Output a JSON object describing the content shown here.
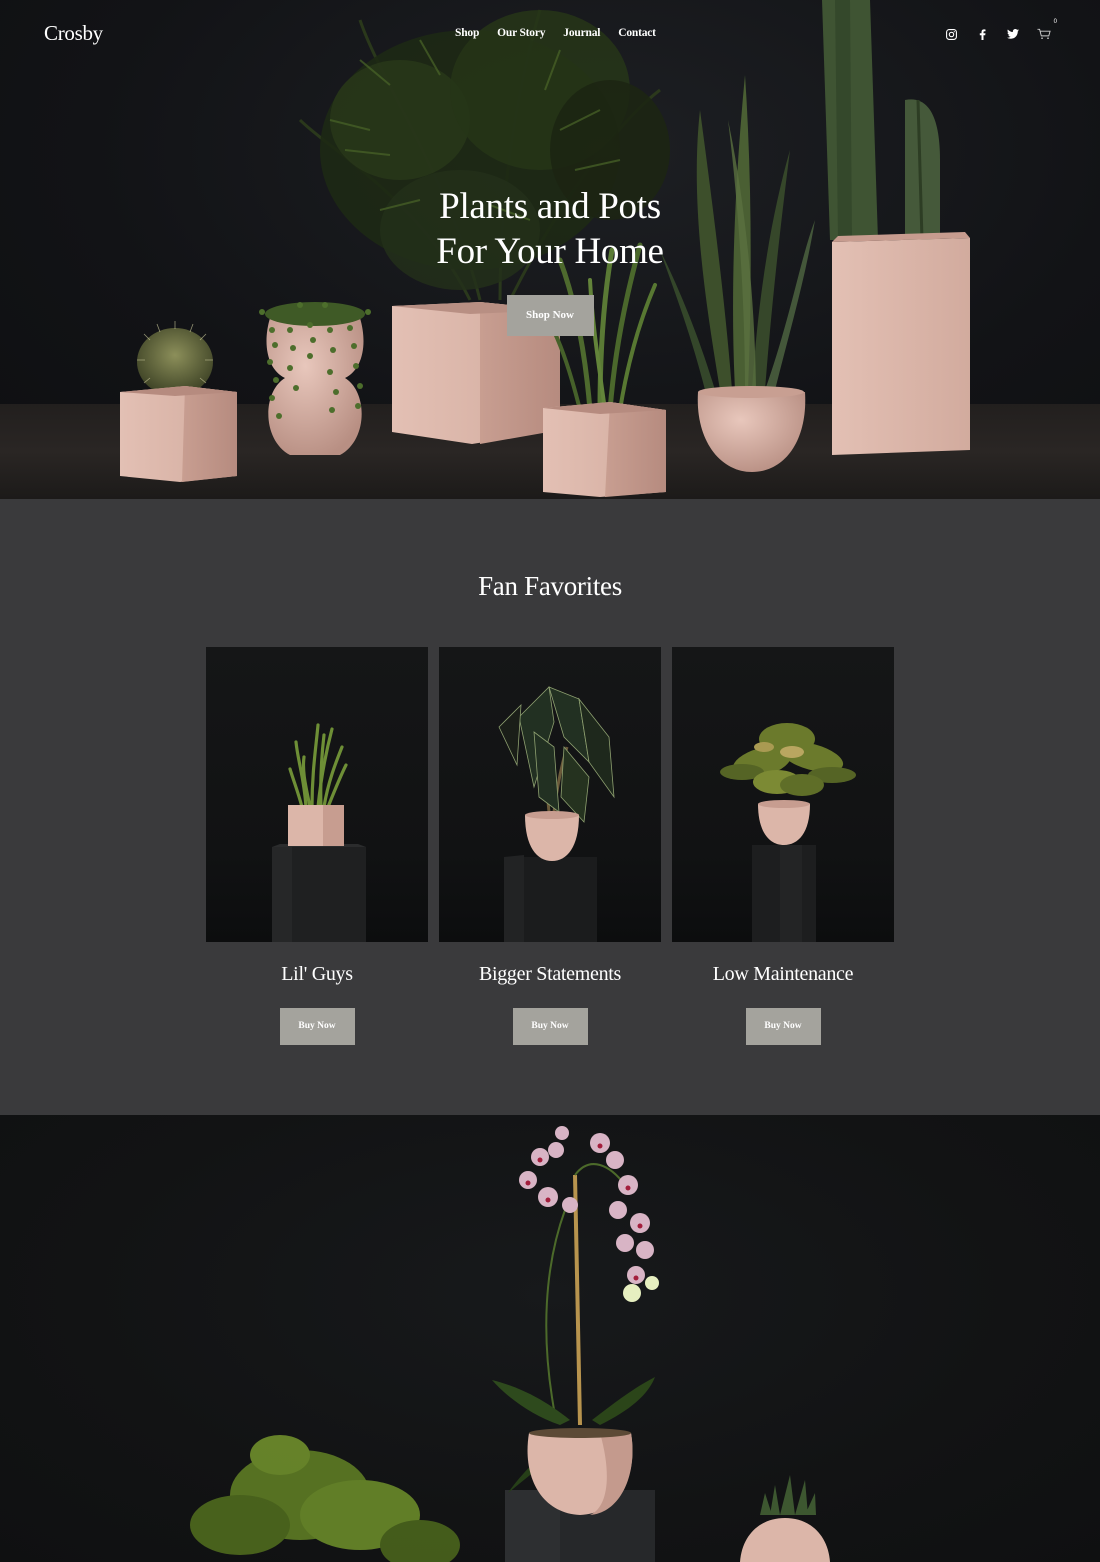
{
  "header": {
    "logo": "Crosby",
    "nav": [
      {
        "label": "Shop"
      },
      {
        "label": "Our Story"
      },
      {
        "label": "Journal"
      },
      {
        "label": "Contact"
      }
    ],
    "social": [
      {
        "icon": "instagram-icon"
      },
      {
        "icon": "facebook-icon"
      },
      {
        "icon": "twitter-icon"
      }
    ],
    "cart": {
      "icon": "cart-icon",
      "count": "0"
    }
  },
  "hero": {
    "title_line1": "Plants and Pots",
    "title_line2": "For Your Home",
    "cta_label": "Shop Now"
  },
  "favorites": {
    "title": "Fan Favorites",
    "cards": [
      {
        "title": "Lil' Guys",
        "cta_label": "Buy Now",
        "image": "small succulent in pink square pot on black pedestal"
      },
      {
        "title": "Bigger Statements",
        "cta_label": "Buy Now",
        "image": "alocasia plant in pink round pot on black pedestal"
      },
      {
        "title": "Low Maintenance",
        "cta_label": "Buy Now",
        "image": "leafy plant in pink round pot on black pedestal"
      }
    ]
  },
  "feature": {
    "image": "pink orchid in pink egg pot on pedestal with fern and succulent"
  },
  "colors": {
    "hero_bg": "#121316",
    "favorites_bg": "#3a3a3c",
    "feature_bg": "#121314",
    "button_bg": "#a4a39d",
    "pot_pink": "#d9b3a6",
    "text": "#ffffff"
  }
}
